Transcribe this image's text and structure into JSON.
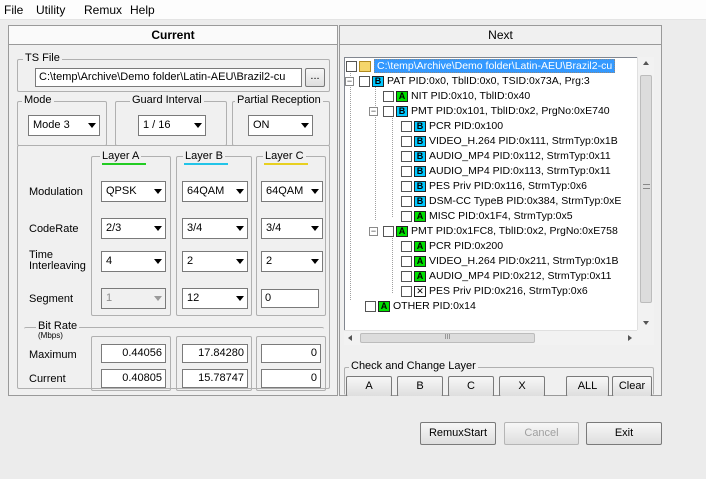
{
  "menu": {
    "items": [
      "File",
      "Utility",
      "Remux",
      "Help"
    ]
  },
  "tabs": {
    "current": "Current",
    "next": "Next"
  },
  "ts_file": {
    "label": "TS File",
    "path": "C:\\temp\\Archive\\Demo folder\\Latin-AEU\\Brazil2-cu",
    "browse": "..."
  },
  "mode": {
    "label": "Mode",
    "value": "Mode 3"
  },
  "guard": {
    "label": "Guard Interval",
    "value": "1 / 16"
  },
  "partial": {
    "label": "Partial Reception",
    "value": "ON"
  },
  "layers": {
    "headers": [
      "Layer A",
      "Layer B",
      "Layer C"
    ],
    "underline_colors": [
      "#22cc22",
      "#22c4e8",
      "#e8d020"
    ],
    "row_labels": {
      "modulation": "Modulation",
      "coderate": "CodeRate",
      "time1": "Time",
      "time2": "Interleaving",
      "segment": "Segment"
    },
    "modulation": [
      "QPSK",
      "64QAM",
      "64QAM"
    ],
    "coderate": [
      "2/3",
      "3/4",
      "3/4"
    ],
    "time_interleaving": [
      "4",
      "2",
      "2"
    ],
    "segment": [
      "1",
      "12",
      "0"
    ]
  },
  "bitrate": {
    "label": "Bit Rate",
    "unit": "(Mbps)",
    "maximum_label": "Maximum",
    "current_label": "Current",
    "maximum": [
      "0.44056",
      "17.84280",
      "0"
    ],
    "current": [
      "0.40805",
      "15.78747",
      "0"
    ]
  },
  "tree": {
    "items": [
      {
        "text": "C:\\temp\\Archive\\Demo folder\\Latin-AEU\\Brazil2-cu",
        "badge": "folder"
      },
      {
        "text": "PAT PID:0x0, TblID:0x0, TSID:0x73A, Prg:3",
        "badge": "B"
      },
      {
        "text": "NIT PID:0x10, TblID:0x40",
        "badge": "A"
      },
      {
        "text": "PMT PID:0x101, TblID:0x2, PrgNo:0xE740",
        "badge": "B"
      },
      {
        "text": "PCR PID:0x100",
        "badge": "B"
      },
      {
        "text": "VIDEO_H.264 PID:0x111, StrmTyp:0x1B",
        "badge": "B"
      },
      {
        "text": "AUDIO_MP4 PID:0x112, StrmTyp:0x11",
        "badge": "B"
      },
      {
        "text": "AUDIO_MP4 PID:0x113, StrmTyp:0x11",
        "badge": "B"
      },
      {
        "text": "PES Priv PID:0x116, StrmTyp:0x6",
        "badge": "B"
      },
      {
        "text": "DSM-CC TypeB PID:0x384, StrmTyp:0xE",
        "badge": "B"
      },
      {
        "text": "MISC PID:0x1F4, StrmTyp:0x5",
        "badge": "A"
      },
      {
        "text": "PMT PID:0x1FC8, TblID:0x2, PrgNo:0xE758",
        "badge": "A"
      },
      {
        "text": "PCR PID:0x200",
        "badge": "A"
      },
      {
        "text": "VIDEO_H.264 PID:0x211, StrmTyp:0x1B",
        "badge": "A"
      },
      {
        "text": "AUDIO_MP4 PID:0x212, StrmTyp:0x11",
        "badge": "A"
      },
      {
        "text": "PES Priv PID:0x216, StrmTyp:0x6",
        "badge": "X"
      },
      {
        "text": "OTHER PID:0x14",
        "badge": "A"
      }
    ],
    "scroll_thumb": "III"
  },
  "change_layer": {
    "label": "Check and Change Layer",
    "buttons": [
      "A",
      "B",
      "C",
      "X",
      "ALL",
      "Clear"
    ]
  },
  "actions": {
    "remux_start": "RemuxStart",
    "cancel": "Cancel",
    "exit": "Exit"
  },
  "colors": {
    "layer_a": "#00e000",
    "layer_b": "#00c8ff",
    "selection": "#3399ff"
  }
}
